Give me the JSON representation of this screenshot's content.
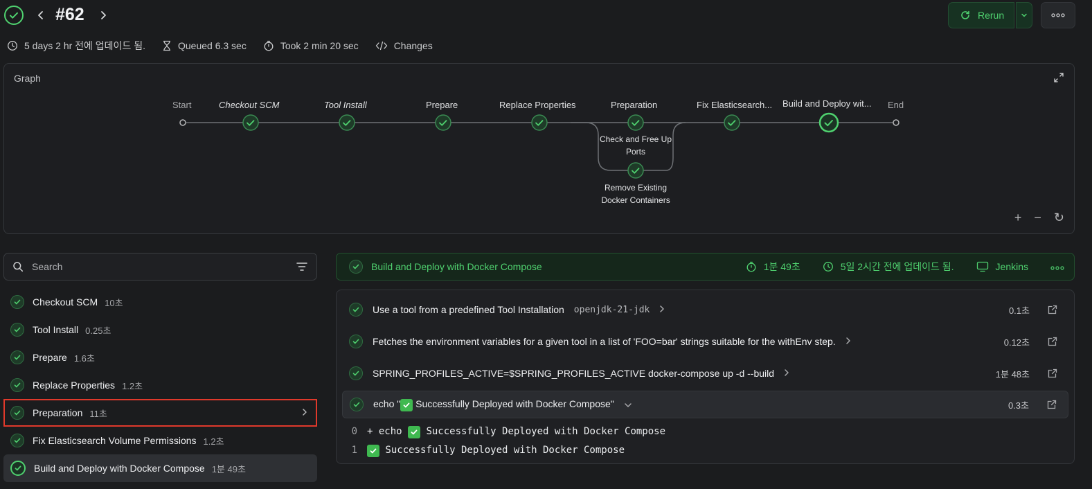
{
  "header": {
    "build_number": "#62",
    "rerun_label": "Rerun",
    "status_icon": "check-circle-icon"
  },
  "meta": {
    "updated": "5 days 2 hr 전에 업데이드 됨.",
    "queued": "Queued 6.3 sec",
    "took": "Took 2 min 20 sec",
    "changes": "Changes"
  },
  "graph": {
    "title": "Graph",
    "start": "Start",
    "end": "End",
    "nodes": [
      {
        "label": "Checkout SCM"
      },
      {
        "label": "Tool Install"
      },
      {
        "label": "Prepare"
      },
      {
        "label": "Replace Properties"
      },
      {
        "label": "Preparation"
      },
      {
        "label": "Fix Elasticsearch..."
      },
      {
        "label": "Build and Deploy wit..."
      }
    ],
    "parallel": [
      "Check and Free Up Ports",
      "Remove Existing Docker Containers"
    ],
    "controls": [
      "+",
      "−",
      "↻"
    ]
  },
  "search": {
    "placeholder": "Search"
  },
  "stages": [
    {
      "name": "Checkout SCM",
      "duration": "10초"
    },
    {
      "name": "Tool Install",
      "duration": "0.25초"
    },
    {
      "name": "Prepare",
      "duration": "1.6초"
    },
    {
      "name": "Replace Properties",
      "duration": "1.2초"
    },
    {
      "name": "Preparation",
      "duration": "11초"
    },
    {
      "name": "Fix Elasticsearch Volume Permissions",
      "duration": "1.2초"
    },
    {
      "name": "Build and Deploy with Docker Compose",
      "duration": "1분 49초"
    }
  ],
  "detail": {
    "title": "Build and Deploy with Docker Compose",
    "duration": "1분 49초",
    "updated": "5일 2시간 전에 업데이드 됨.",
    "agent": "Jenkins"
  },
  "steps": [
    {
      "text": "Use a tool from a predefined Tool Installation",
      "arg": "openjdk-21-jdk",
      "duration": "0.1초"
    },
    {
      "text": "Fetches the environment variables for a given tool in a list of 'FOO=bar' strings suitable for the withEnv step.",
      "arg": "",
      "duration": "0.12초"
    },
    {
      "text": "SPRING_PROFILES_ACTIVE=$SPRING_PROFILES_ACTIVE docker-compose up -d --build",
      "arg": "",
      "duration": "1분 48초"
    },
    {
      "text_before": "echo \"",
      "text_after": " Successfully Deployed with Docker Compose\"",
      "arg": "",
      "duration": "0.3초"
    }
  ],
  "log": [
    {
      "ln": "0",
      "before": "+ echo ",
      "after": " Successfully Deployed with Docker Compose"
    },
    {
      "ln": "1",
      "before": "",
      "after": " Successfully Deployed with Docker Compose"
    }
  ]
}
